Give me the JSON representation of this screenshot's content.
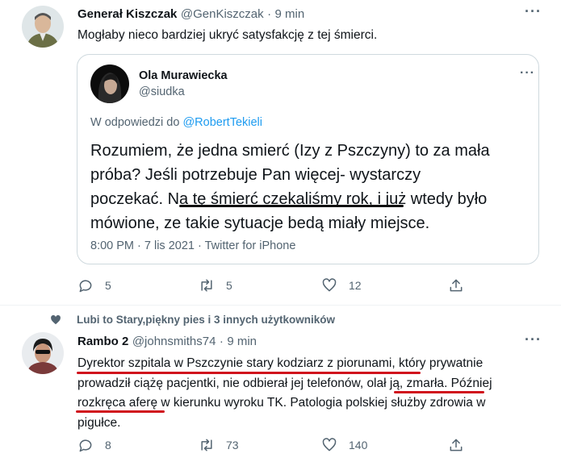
{
  "tweet1": {
    "author_name": "Generał Kiszczak",
    "handle": "@GenKiszczak",
    "sep": "·",
    "time": "9 min",
    "text": "Mogłaby nieco bardziej ukryć satysfakcję z tej śmierci.",
    "quote": {
      "author_name": "Ola Murawiecka",
      "handle": "@siudka",
      "reply_prefix": "W odpowiedzi do",
      "reply_to": "@RobertTekieli",
      "lines": [
        "Rozumiem, że jedna smierć (Izy z Pszczyny) to za mała",
        "próba? Jeśli potrzebuje Pan więcej- wystarczy",
        "poczekać. ",
        "Na tę śmierć czekaliśmy rok",
        ", i już wtedy było",
        "mówione, ze takie sytuacje bedą miały miejsce."
      ],
      "footer": "8:00 PM · 7 lis 2021 · Twitter for iPhone"
    },
    "actions": {
      "replies": "5",
      "retweets": "5",
      "likes": "12"
    }
  },
  "tweet2": {
    "liked_by": "Lubi to Stary,piękny pies i 3 innych użytkowników",
    "author_name": "Rambo 2",
    "handle": "@johnsmiths74",
    "sep": "·",
    "time": "9 min",
    "lines": [
      "Dyrektor szpitala w Pszczynie stary kodziarz z piorunami",
      ", który prywatnie",
      "prowadził ciążę pacjentki, nie odbierał jej telefonów, ",
      "olał ją, zmarła",
      ". Później",
      "rozkręca aferę",
      " w kierunku wyroku TK. Patologia polskiej służby zdrowia w",
      "pigułce."
    ],
    "actions": {
      "replies": "8",
      "retweets": "73",
      "likes": "140"
    }
  },
  "icons": {
    "more": "more-icon",
    "reply": "reply-icon",
    "retweet": "retweet-icon",
    "like": "heart-icon",
    "share": "share-icon"
  },
  "colors": {
    "link": "#1d9bf0",
    "muted": "#536471",
    "underline_red": "#d0101c"
  }
}
